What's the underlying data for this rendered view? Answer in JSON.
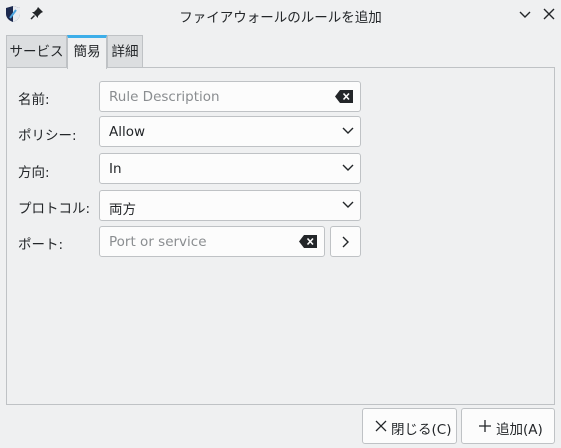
{
  "window": {
    "title": "ファイアウォールのルールを追加"
  },
  "tabs": [
    {
      "label": "サービス",
      "active": false
    },
    {
      "label": "簡易",
      "active": true
    },
    {
      "label": "詳細",
      "active": false
    }
  ],
  "form": {
    "name_label": "名前:",
    "name_placeholder": "Rule Description",
    "policy_label": "ポリシー:",
    "policy_value": "Allow",
    "direction_label": "方向:",
    "direction_value": "In",
    "protocol_label": "プロトコル:",
    "protocol_value": "両方",
    "port_label": "ポート:",
    "port_placeholder": "Port or service"
  },
  "buttons": {
    "close_label": "閉じる(C)",
    "add_label": "追加(A)"
  },
  "colors": {
    "accent": "#3daee9",
    "background": "#eff0f1",
    "border": "#bfc2c5"
  },
  "icons": [
    "app-shield-icon",
    "pin-icon",
    "minimize-chevron-icon",
    "close-icon",
    "clear-text-icon",
    "chevron-down-icon",
    "chevron-right-icon",
    "plus-icon"
  ]
}
